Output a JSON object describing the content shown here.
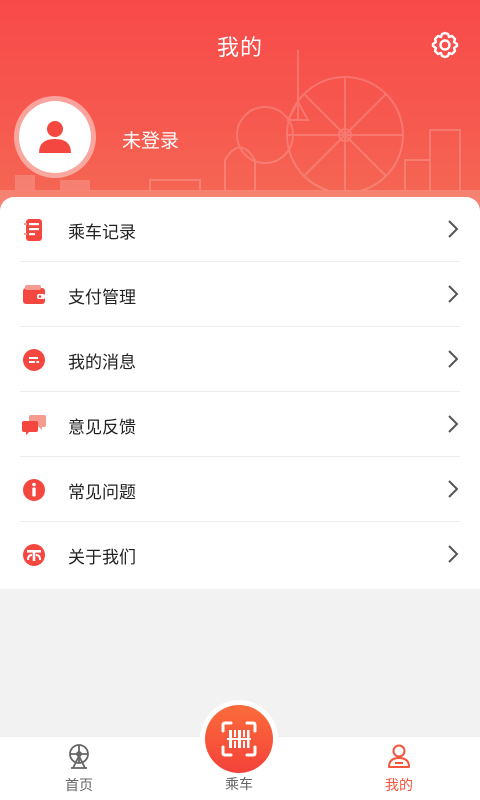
{
  "header": {
    "title": "我的",
    "user_status": "未登录"
  },
  "colors": {
    "accent": "#f5553c",
    "header_top": "#f84a4a",
    "header_bottom": "#f46a55"
  },
  "menu": [
    {
      "label": "乘车记录",
      "icon": "ride-record-icon"
    },
    {
      "label": "支付管理",
      "icon": "wallet-icon"
    },
    {
      "label": "我的消息",
      "icon": "message-icon"
    },
    {
      "label": "意见反馈",
      "icon": "feedback-icon"
    },
    {
      "label": "常见问题",
      "icon": "info-icon"
    },
    {
      "label": "关于我们",
      "icon": "about-icon"
    }
  ],
  "tabbar": {
    "home": "首页",
    "ride": "乘车",
    "mine": "我的",
    "active": "mine"
  }
}
